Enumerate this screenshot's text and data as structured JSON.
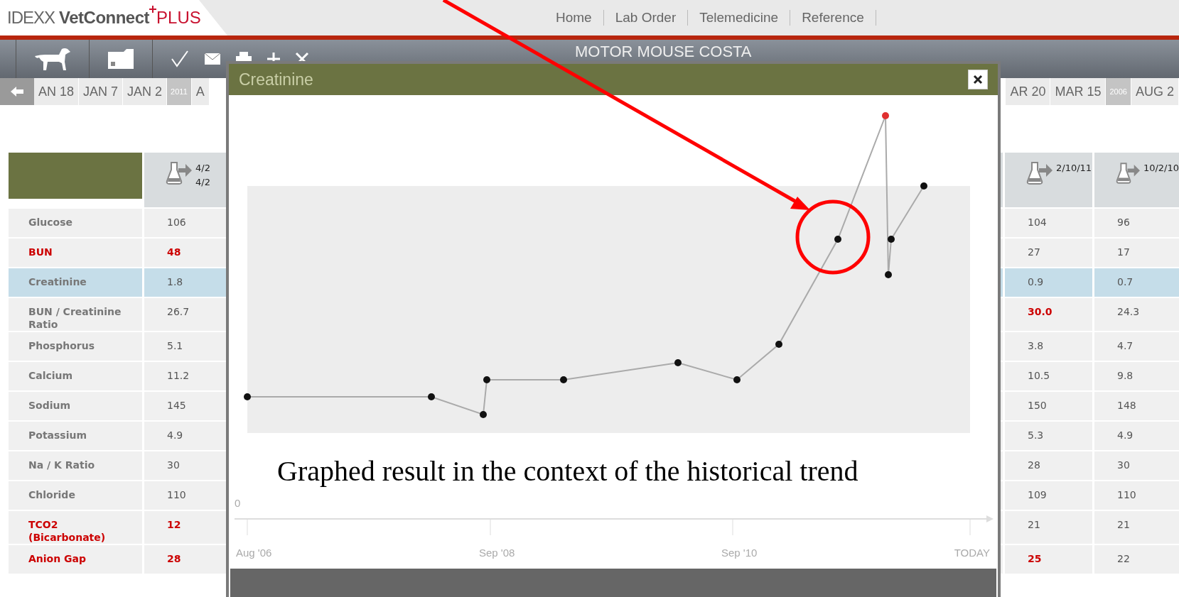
{
  "header": {
    "logo": {
      "brand": "IDEXX",
      "product": "VetConnect",
      "suffix": "PLUS"
    },
    "nav": [
      {
        "label": "Home"
      },
      {
        "label": "Lab Order"
      },
      {
        "label": "Telemedicine"
      },
      {
        "label": "Reference"
      }
    ]
  },
  "toolbar": {
    "patient": "MOTOR MOUSE COSTA"
  },
  "timeline": {
    "left": [
      {
        "label": "AN 18",
        "kind": "date"
      },
      {
        "label": "JAN 7",
        "kind": "date"
      },
      {
        "label": "JAN 2",
        "kind": "date"
      },
      {
        "label": "2011",
        "kind": "year"
      },
      {
        "label": "A",
        "kind": "date"
      }
    ],
    "right": [
      {
        "label": "AR 20",
        "kind": "date"
      },
      {
        "label": "MAR 15",
        "kind": "date"
      },
      {
        "label": "2006",
        "kind": "year"
      },
      {
        "label": "AUG 2",
        "kind": "date"
      }
    ]
  },
  "table": {
    "columns": [
      {
        "dates": [
          "4/2",
          "4/2"
        ]
      },
      {
        "dates": [
          "2/10/11"
        ]
      },
      {
        "dates": [
          "10/2/10"
        ]
      }
    ],
    "rows": [
      {
        "name": "Glucose",
        "abnormal": false,
        "selected": false,
        "values": [
          {
            "text": "106",
            "abnormal": false
          },
          {
            "text": "104",
            "abnormal": false
          },
          {
            "text": "96",
            "abnormal": false
          }
        ]
      },
      {
        "name": "BUN",
        "abnormal": true,
        "selected": false,
        "values": [
          {
            "text": "48",
            "abnormal": true
          },
          {
            "text": "27",
            "abnormal": false
          },
          {
            "text": "17",
            "abnormal": false
          }
        ]
      },
      {
        "name": "Creatinine",
        "abnormal": false,
        "selected": true,
        "values": [
          {
            "text": "1.8",
            "abnormal": false
          },
          {
            "text": "0.9",
            "abnormal": false
          },
          {
            "text": "0.7",
            "abnormal": false
          }
        ]
      },
      {
        "name": "BUN / Creatinine Ratio",
        "abnormal": false,
        "selected": false,
        "values": [
          {
            "text": "26.7",
            "abnormal": false
          },
          {
            "text": "30.0",
            "abnormal": true
          },
          {
            "text": "24.3",
            "abnormal": false
          }
        ]
      },
      {
        "name": "Phosphorus",
        "abnormal": false,
        "selected": false,
        "values": [
          {
            "text": "5.1",
            "abnormal": false
          },
          {
            "text": "3.8",
            "abnormal": false
          },
          {
            "text": "4.7",
            "abnormal": false
          }
        ]
      },
      {
        "name": "Calcium",
        "abnormal": false,
        "selected": false,
        "values": [
          {
            "text": "11.2",
            "abnormal": false
          },
          {
            "text": "10.5",
            "abnormal": false
          },
          {
            "text": "9.8",
            "abnormal": false
          }
        ]
      },
      {
        "name": "Sodium",
        "abnormal": false,
        "selected": false,
        "values": [
          {
            "text": "145",
            "abnormal": false
          },
          {
            "text": "150",
            "abnormal": false
          },
          {
            "text": "148",
            "abnormal": false
          }
        ]
      },
      {
        "name": "Potassium",
        "abnormal": false,
        "selected": false,
        "values": [
          {
            "text": "4.9",
            "abnormal": false
          },
          {
            "text": "5.3",
            "abnormal": false
          },
          {
            "text": "4.9",
            "abnormal": false
          }
        ]
      },
      {
        "name": "Na / K Ratio",
        "abnormal": false,
        "selected": false,
        "values": [
          {
            "text": "30",
            "abnormal": false
          },
          {
            "text": "28",
            "abnormal": false
          },
          {
            "text": "30",
            "abnormal": false
          }
        ]
      },
      {
        "name": "Chloride",
        "abnormal": false,
        "selected": false,
        "values": [
          {
            "text": "110",
            "abnormal": false
          },
          {
            "text": "109",
            "abnormal": false
          },
          {
            "text": "110",
            "abnormal": false
          }
        ]
      },
      {
        "name": "TCO2 (Bicarbonate)",
        "abnormal": true,
        "selected": false,
        "values": [
          {
            "text": "12",
            "abnormal": true
          },
          {
            "text": "21",
            "abnormal": false
          },
          {
            "text": "21",
            "abnormal": false
          }
        ]
      },
      {
        "name": "Anion Gap",
        "abnormal": true,
        "selected": false,
        "values": [
          {
            "text": "28",
            "abnormal": true
          },
          {
            "text": "25",
            "abnormal": true
          },
          {
            "text": "22",
            "abnormal": false
          }
        ]
      }
    ]
  },
  "popup": {
    "title": "Creatinine",
    "chart": {
      "y_label": "0",
      "x_labels": [
        "Aug '06",
        "Sep '08",
        "Sep '10",
        "TODAY"
      ]
    }
  },
  "annotation": {
    "caption": "Graphed result in the context of the historical trend"
  }
}
